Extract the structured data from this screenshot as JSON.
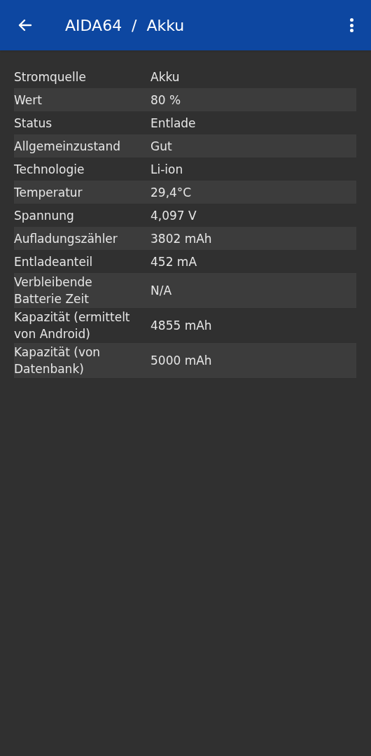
{
  "app_bar": {
    "title": "AIDA64  /  Akku"
  },
  "rows": [
    {
      "label": "Stromquelle",
      "value": "Akku"
    },
    {
      "label": "Wert",
      "value": "80 %"
    },
    {
      "label": "Status",
      "value": "Entlade"
    },
    {
      "label": "Allgemeinzustand",
      "value": "Gut"
    },
    {
      "label": "Technologie",
      "value": "Li-ion"
    },
    {
      "label": "Temperatur",
      "value": "29,4°C"
    },
    {
      "label": "Spannung",
      "value": "4,097 V"
    },
    {
      "label": "Aufladungszähler",
      "value": "3802 mAh"
    },
    {
      "label": "Entladeanteil",
      "value": "452 mA"
    },
    {
      "label": "Verbleibende Batterie Zeit",
      "value": "N/A"
    },
    {
      "label": "Kapazität (ermittelt von Android)",
      "value": "4855 mAh"
    },
    {
      "label": "Kapazität (von Datenbank)",
      "value": "5000 mAh"
    }
  ]
}
